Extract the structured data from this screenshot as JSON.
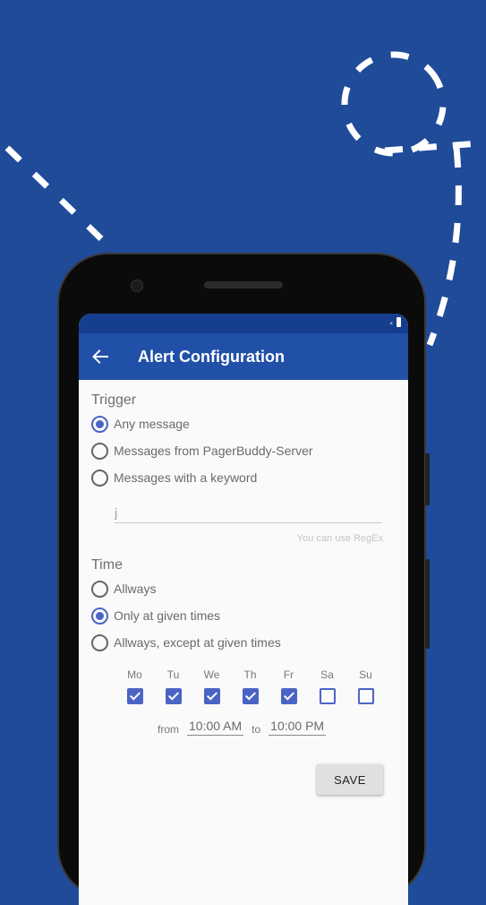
{
  "app": {
    "title": "Alert Configuration"
  },
  "trigger": {
    "title": "Trigger",
    "options": [
      {
        "label": "Any message",
        "checked": true
      },
      {
        "label": "Messages from PagerBuddy-Server",
        "checked": false
      },
      {
        "label": "Messages with a keyword",
        "checked": false
      }
    ],
    "keyword_value": "j",
    "keyword_hint": "You can use RegEx"
  },
  "time": {
    "title": "Time",
    "options": [
      {
        "label": "Allways",
        "checked": false
      },
      {
        "label": "Only at given times",
        "checked": true
      },
      {
        "label": "Allways, except at given times",
        "checked": false
      }
    ],
    "days": [
      {
        "label": "Mo",
        "checked": true
      },
      {
        "label": "Tu",
        "checked": true
      },
      {
        "label": "We",
        "checked": true
      },
      {
        "label": "Th",
        "checked": true
      },
      {
        "label": "Fr",
        "checked": true
      },
      {
        "label": "Sa",
        "checked": false
      },
      {
        "label": "Su",
        "checked": false
      }
    ],
    "from_label": "from",
    "from_value": "10:00 AM",
    "to_label": "to",
    "to_value": "10:00 PM"
  },
  "actions": {
    "save_label": "SAVE"
  },
  "icons": {
    "back": "arrow-back-icon"
  },
  "colors": {
    "background": "#1f4b99",
    "appbar": "#2150a8",
    "statusbar": "#153f8e",
    "accent": "#4a64c4"
  }
}
